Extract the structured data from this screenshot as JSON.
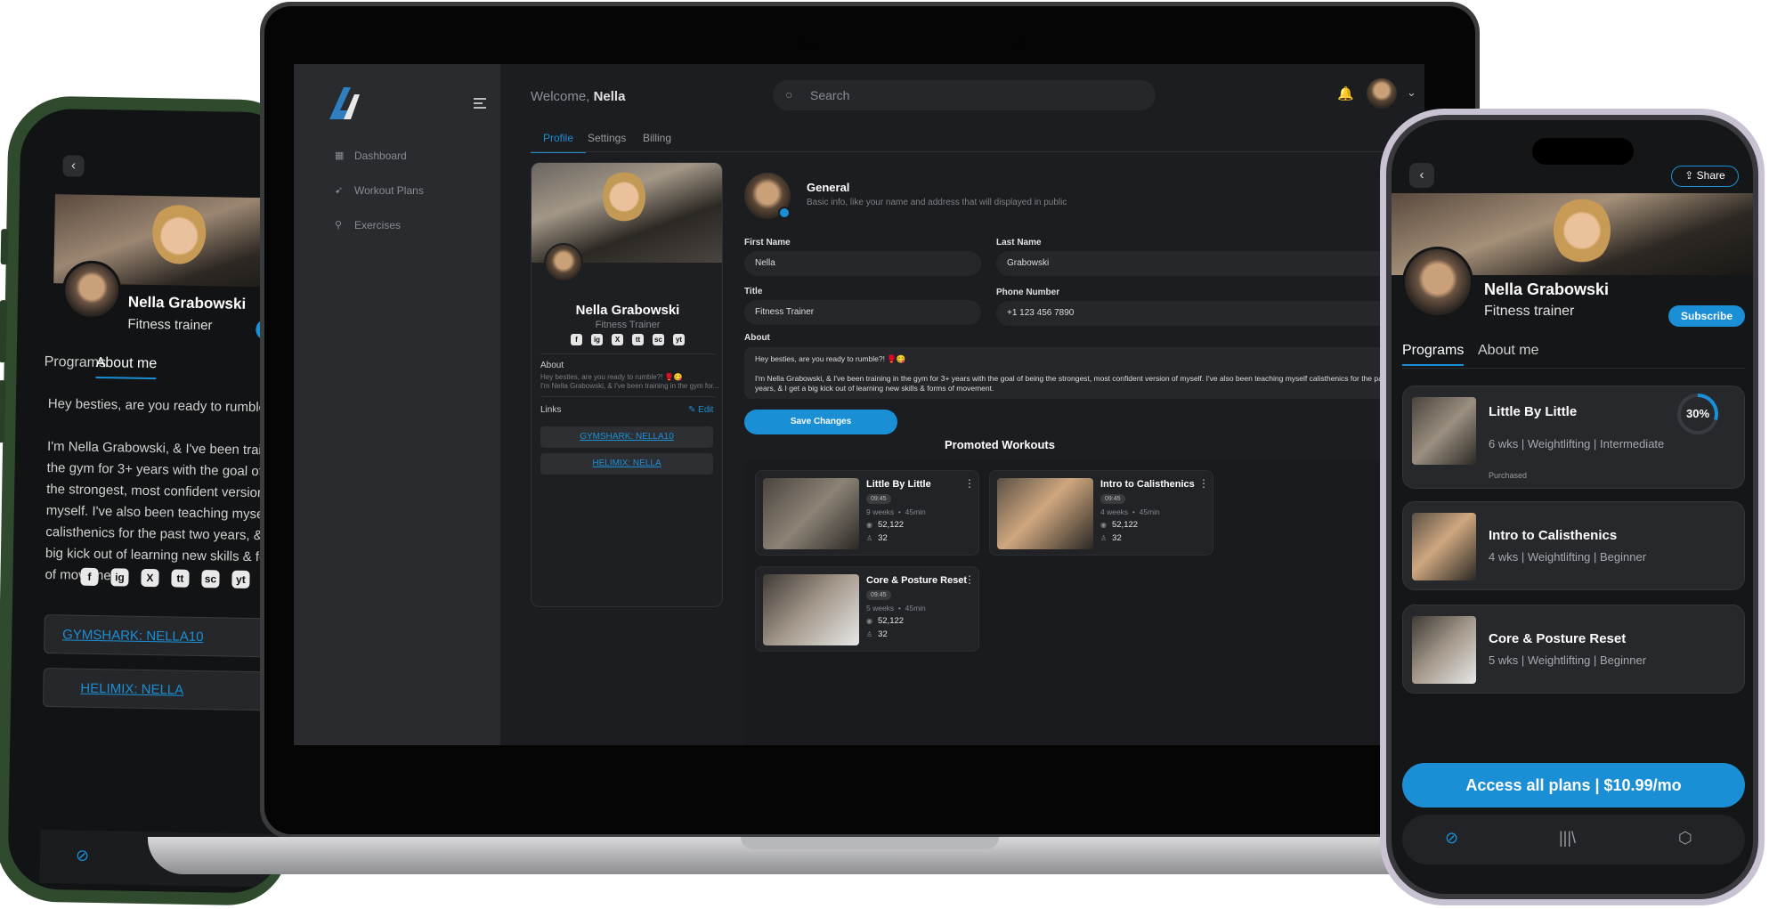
{
  "profile": {
    "name": "Nella Grabowski",
    "role_mobile": "Fitness trainer",
    "role_desktop": "Fitness Trainer",
    "first_name": "Nella",
    "last_name": "Grabowski",
    "title": "Fitness Trainer",
    "phone": "+1 123 456 7890",
    "about_short_1": "Hey besties, are you ready to rumble?! 🥊😋",
    "about_short_2": "I'm Nella Grabowski, & I've been training in the gym for...",
    "about_field": "Hey besties, are you ready to rumble?! 🥊😋\n\nI'm Nella Grabowski, & I've been training in the gym for 3+ years with the goal of being the strongest, most confident version of myself. I've also been teaching myself calisthenics for the past two years, & I get a big kick out of learning new skills & forms of movement.",
    "about_mobile": "Hey besties, are you ready to rumble?! 🥊\n\nI'm Nella Grabowski, & I've been training in the gym for 3+ years with the goal of being the strongest, most confident version of myself. I've also been teaching myself calisthenics for the past two years, & I get a big kick out of learning new skills & forms of movement."
  },
  "links": [
    "GYMSHARK: NELLA10",
    "HELIMIX: NELLA"
  ],
  "socials": [
    "f",
    "ig",
    "X",
    "tt",
    "sc",
    "yt"
  ],
  "left_phone": {
    "tabs": [
      "Programs",
      "About me"
    ],
    "subscribe_label": "Su"
  },
  "laptop": {
    "welcome": "Welcome,",
    "user": "Nella",
    "search_placeholder": "Search",
    "sidebar": [
      {
        "label": "Dashboard",
        "icon": "dashboard-icon"
      },
      {
        "label": "Workout Plans",
        "icon": "workout-plans-icon"
      },
      {
        "label": "Exercises",
        "icon": "bike-icon"
      }
    ],
    "tabs": [
      "Profile",
      "Settings",
      "Billing"
    ],
    "card_about_label": "About",
    "card_links_label": "Links",
    "edit_label": "Edit",
    "general_title": "General",
    "general_sub": "Basic info, like your name and address that will displayed in public",
    "labels": {
      "first_name": "First Name",
      "last_name": "Last Name",
      "title": "Title",
      "phone": "Phone Number",
      "about": "About"
    },
    "save_label": "Save Changes",
    "promoted_title": "Promoted Workouts",
    "workouts": [
      {
        "title": "Little By Little",
        "time": "09:45",
        "weeks": "9 weeks",
        "mins": "45min",
        "views": "52,122",
        "users": "32"
      },
      {
        "title": "Intro to Calisthenics",
        "time": "09:45",
        "weeks": "4 weeks",
        "mins": "45min",
        "views": "52,122",
        "users": "32"
      },
      {
        "title": "Core & Posture Reset",
        "time": "09:45",
        "weeks": "5 weeks",
        "mins": "45min",
        "views": "52,122",
        "users": "32"
      }
    ]
  },
  "right_phone": {
    "share_label": "Share",
    "subscribe_label": "Subscribe",
    "tabs": [
      "Programs",
      "About me"
    ],
    "programs": [
      {
        "title": "Little By Little",
        "meta": "6 wks | Weightlifting   | Intermediate",
        "status": "Purchased",
        "progress": "30%"
      },
      {
        "title": "Intro to Calisthenics",
        "meta": "4 wks | Weightlifting   | Beginner"
      },
      {
        "title": "Core & Posture Reset",
        "meta": "5 wks | Weightlifting   | Beginner"
      }
    ],
    "cta_label": "Access all plans | $10.99/mo"
  },
  "colors": {
    "accent": "#1b8fd6",
    "background": "#1c1d20",
    "card": "#27282b"
  }
}
